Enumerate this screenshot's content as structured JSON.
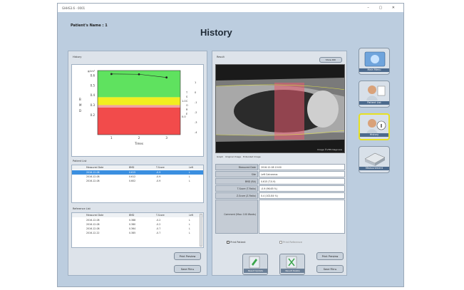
{
  "window": {
    "title": "GHHS3.6 - 0001",
    "controls": "– ▢ ✕"
  },
  "header": {
    "patient_label": "Patient's Name :",
    "patient_value": "1",
    "title": "History"
  },
  "left": {
    "history_label": "History",
    "chart_data": {
      "type": "line",
      "title": "",
      "xlabel": "Times",
      "ylabel": "",
      "y_unit": "g/cm²",
      "x": [
        1,
        2,
        3
      ],
      "series": [
        {
          "values": [
            0.615,
            0.612,
            0.58
          ]
        }
      ],
      "ylim": [
        0.0,
        0.65
      ],
      "y_ticks": [
        "0.6",
        "0.5",
        "0.4",
        "0.3",
        "0.2"
      ],
      "x_ticks": [
        "1",
        "2",
        "3"
      ],
      "left_axis_letters": [
        "B",
        "M",
        "D"
      ],
      "right_ticks": [
        "1",
        "0",
        "-1",
        "-2",
        "-3",
        "-4"
      ],
      "right_axis_letters": [
        "T",
        "S",
        "C",
        "O",
        "R",
        "E"
      ],
      "right_mid_labels": [
        "1.0",
        "0.0"
      ],
      "grid": false,
      "bands": [
        {
          "from": 0.0,
          "to": 0.275,
          "color": "#f24b4b"
        },
        {
          "from": 0.275,
          "to": 0.3,
          "color": "#f0a0a0"
        },
        {
          "from": 0.3,
          "to": 0.38,
          "color": "#f2ee1f"
        },
        {
          "from": 0.38,
          "to": 0.65,
          "color": "#5fe25f"
        }
      ]
    },
    "patient_list": {
      "label": "Patient List",
      "headers": [
        "Measured Date",
        "BMD",
        "T-Score",
        "Left"
      ],
      "rows": [
        [
          "2016-12-08",
          "0.615",
          "-0.9",
          "L",
          true
        ],
        [
          "2016-12-08",
          "0.612",
          "-0.9",
          "L",
          false
        ],
        [
          "2016-12-08",
          "0.602",
          "-0.9",
          "L",
          false
        ]
      ]
    },
    "reference_list": {
      "label": "Reference List",
      "headers": [
        "Measured Date",
        "BMD",
        "T-Score",
        "Left"
      ],
      "rows": [
        [
          "2016-12-08",
          "0.388",
          "-0.2",
          "L"
        ],
        [
          "2016-12-08",
          "0.380",
          "-0.2",
          "L"
        ],
        [
          "2016-12-08",
          "0.364",
          "-0.7",
          "L"
        ],
        [
          "2016-12-22",
          "0.385",
          "-0.7",
          "L"
        ]
      ]
    },
    "print_button": "Print Preview",
    "save_button": "Save File ▸"
  },
  "center": {
    "result_label": "Result",
    "show_roi_button": "Show ROI",
    "image_caption": "Image ©VTB Diagnosis",
    "image_tabs": [
      "Graph",
      "Original Image",
      "Extended Image"
    ],
    "info": [
      {
        "label": "Measured Date",
        "value": "2016-12-08 10:00"
      },
      {
        "label": "Site",
        "value": "Left Calcaneus"
      },
      {
        "label": "BMD (BA)",
        "value": "0.615 (T-0.9)"
      },
      {
        "label": "T-Score (T-Ratio)",
        "value": "-0.9 (96.65 %)"
      },
      {
        "label": "Z-Score (Z-Ratio)",
        "value": "0.4 (102.84 %)"
      }
    ],
    "comment_label": "Comment (Max: 100 Words)",
    "check_patient": "Print Patient",
    "check_reference": "Print Reference",
    "print_button": "Print Preview",
    "save_button": "Save File ▸",
    "result_update": "Result Update",
    "result_delete": "Result Delete"
  },
  "sidebar": {
    "main_menu": "Main Menu",
    "patient_list": "Patient List",
    "history": "History",
    "measurement": "Measurement"
  },
  "colors": {
    "roi": "#e85a6e",
    "accent": "#e6e023"
  }
}
